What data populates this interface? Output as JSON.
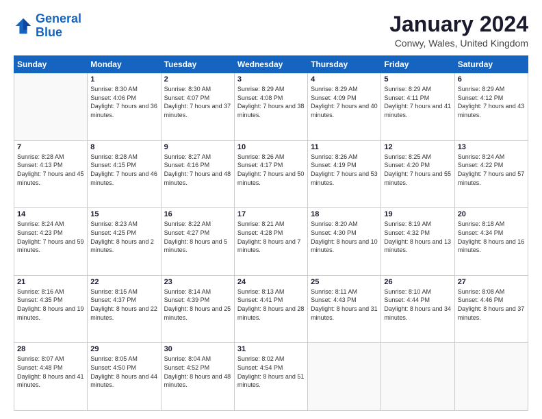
{
  "header": {
    "logo_line1": "General",
    "logo_line2": "Blue",
    "title": "January 2024",
    "subtitle": "Conwy, Wales, United Kingdom"
  },
  "weekdays": [
    "Sunday",
    "Monday",
    "Tuesday",
    "Wednesday",
    "Thursday",
    "Friday",
    "Saturday"
  ],
  "weeks": [
    [
      {
        "day": "",
        "sunrise": "",
        "sunset": "",
        "daylight": ""
      },
      {
        "day": "1",
        "sunrise": "Sunrise: 8:30 AM",
        "sunset": "Sunset: 4:06 PM",
        "daylight": "Daylight: 7 hours and 36 minutes."
      },
      {
        "day": "2",
        "sunrise": "Sunrise: 8:30 AM",
        "sunset": "Sunset: 4:07 PM",
        "daylight": "Daylight: 7 hours and 37 minutes."
      },
      {
        "day": "3",
        "sunrise": "Sunrise: 8:29 AM",
        "sunset": "Sunset: 4:08 PM",
        "daylight": "Daylight: 7 hours and 38 minutes."
      },
      {
        "day": "4",
        "sunrise": "Sunrise: 8:29 AM",
        "sunset": "Sunset: 4:09 PM",
        "daylight": "Daylight: 7 hours and 40 minutes."
      },
      {
        "day": "5",
        "sunrise": "Sunrise: 8:29 AM",
        "sunset": "Sunset: 4:11 PM",
        "daylight": "Daylight: 7 hours and 41 minutes."
      },
      {
        "day": "6",
        "sunrise": "Sunrise: 8:29 AM",
        "sunset": "Sunset: 4:12 PM",
        "daylight": "Daylight: 7 hours and 43 minutes."
      }
    ],
    [
      {
        "day": "7",
        "sunrise": "Sunrise: 8:28 AM",
        "sunset": "Sunset: 4:13 PM",
        "daylight": "Daylight: 7 hours and 45 minutes."
      },
      {
        "day": "8",
        "sunrise": "Sunrise: 8:28 AM",
        "sunset": "Sunset: 4:15 PM",
        "daylight": "Daylight: 7 hours and 46 minutes."
      },
      {
        "day": "9",
        "sunrise": "Sunrise: 8:27 AM",
        "sunset": "Sunset: 4:16 PM",
        "daylight": "Daylight: 7 hours and 48 minutes."
      },
      {
        "day": "10",
        "sunrise": "Sunrise: 8:26 AM",
        "sunset": "Sunset: 4:17 PM",
        "daylight": "Daylight: 7 hours and 50 minutes."
      },
      {
        "day": "11",
        "sunrise": "Sunrise: 8:26 AM",
        "sunset": "Sunset: 4:19 PM",
        "daylight": "Daylight: 7 hours and 53 minutes."
      },
      {
        "day": "12",
        "sunrise": "Sunrise: 8:25 AM",
        "sunset": "Sunset: 4:20 PM",
        "daylight": "Daylight: 7 hours and 55 minutes."
      },
      {
        "day": "13",
        "sunrise": "Sunrise: 8:24 AM",
        "sunset": "Sunset: 4:22 PM",
        "daylight": "Daylight: 7 hours and 57 minutes."
      }
    ],
    [
      {
        "day": "14",
        "sunrise": "Sunrise: 8:24 AM",
        "sunset": "Sunset: 4:23 PM",
        "daylight": "Daylight: 7 hours and 59 minutes."
      },
      {
        "day": "15",
        "sunrise": "Sunrise: 8:23 AM",
        "sunset": "Sunset: 4:25 PM",
        "daylight": "Daylight: 8 hours and 2 minutes."
      },
      {
        "day": "16",
        "sunrise": "Sunrise: 8:22 AM",
        "sunset": "Sunset: 4:27 PM",
        "daylight": "Daylight: 8 hours and 5 minutes."
      },
      {
        "day": "17",
        "sunrise": "Sunrise: 8:21 AM",
        "sunset": "Sunset: 4:28 PM",
        "daylight": "Daylight: 8 hours and 7 minutes."
      },
      {
        "day": "18",
        "sunrise": "Sunrise: 8:20 AM",
        "sunset": "Sunset: 4:30 PM",
        "daylight": "Daylight: 8 hours and 10 minutes."
      },
      {
        "day": "19",
        "sunrise": "Sunrise: 8:19 AM",
        "sunset": "Sunset: 4:32 PM",
        "daylight": "Daylight: 8 hours and 13 minutes."
      },
      {
        "day": "20",
        "sunrise": "Sunrise: 8:18 AM",
        "sunset": "Sunset: 4:34 PM",
        "daylight": "Daylight: 8 hours and 16 minutes."
      }
    ],
    [
      {
        "day": "21",
        "sunrise": "Sunrise: 8:16 AM",
        "sunset": "Sunset: 4:35 PM",
        "daylight": "Daylight: 8 hours and 19 minutes."
      },
      {
        "day": "22",
        "sunrise": "Sunrise: 8:15 AM",
        "sunset": "Sunset: 4:37 PM",
        "daylight": "Daylight: 8 hours and 22 minutes."
      },
      {
        "day": "23",
        "sunrise": "Sunrise: 8:14 AM",
        "sunset": "Sunset: 4:39 PM",
        "daylight": "Daylight: 8 hours and 25 minutes."
      },
      {
        "day": "24",
        "sunrise": "Sunrise: 8:13 AM",
        "sunset": "Sunset: 4:41 PM",
        "daylight": "Daylight: 8 hours and 28 minutes."
      },
      {
        "day": "25",
        "sunrise": "Sunrise: 8:11 AM",
        "sunset": "Sunset: 4:43 PM",
        "daylight": "Daylight: 8 hours and 31 minutes."
      },
      {
        "day": "26",
        "sunrise": "Sunrise: 8:10 AM",
        "sunset": "Sunset: 4:44 PM",
        "daylight": "Daylight: 8 hours and 34 minutes."
      },
      {
        "day": "27",
        "sunrise": "Sunrise: 8:08 AM",
        "sunset": "Sunset: 4:46 PM",
        "daylight": "Daylight: 8 hours and 37 minutes."
      }
    ],
    [
      {
        "day": "28",
        "sunrise": "Sunrise: 8:07 AM",
        "sunset": "Sunset: 4:48 PM",
        "daylight": "Daylight: 8 hours and 41 minutes."
      },
      {
        "day": "29",
        "sunrise": "Sunrise: 8:05 AM",
        "sunset": "Sunset: 4:50 PM",
        "daylight": "Daylight: 8 hours and 44 minutes."
      },
      {
        "day": "30",
        "sunrise": "Sunrise: 8:04 AM",
        "sunset": "Sunset: 4:52 PM",
        "daylight": "Daylight: 8 hours and 48 minutes."
      },
      {
        "day": "31",
        "sunrise": "Sunrise: 8:02 AM",
        "sunset": "Sunset: 4:54 PM",
        "daylight": "Daylight: 8 hours and 51 minutes."
      },
      {
        "day": "",
        "sunrise": "",
        "sunset": "",
        "daylight": ""
      },
      {
        "day": "",
        "sunrise": "",
        "sunset": "",
        "daylight": ""
      },
      {
        "day": "",
        "sunrise": "",
        "sunset": "",
        "daylight": ""
      }
    ]
  ]
}
